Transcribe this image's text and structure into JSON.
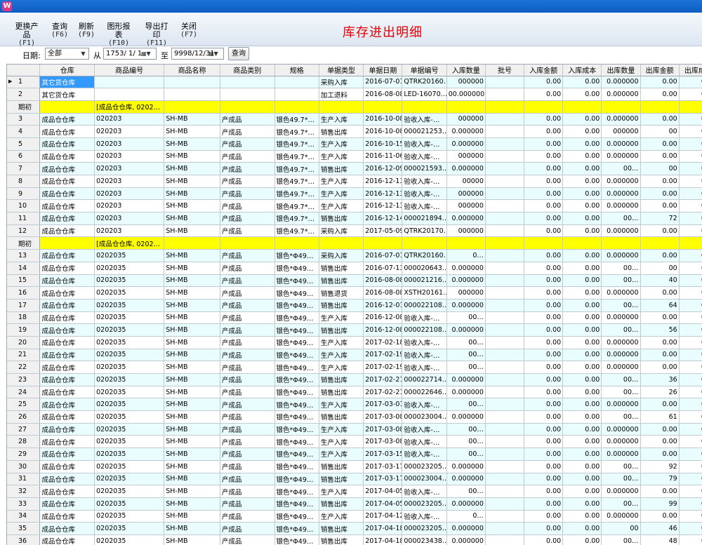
{
  "app_icon": "app-icon",
  "toolbar": {
    "buttons": [
      {
        "label": "更换产品",
        "key": "(F1)"
      },
      {
        "label": "查询",
        "key": "(F6)"
      },
      {
        "label": "刷新",
        "key": "(F9)"
      },
      {
        "label": "图形报表",
        "key": "(F10)"
      },
      {
        "label": "导出打印",
        "key": "(F11)"
      },
      {
        "label": "关闭",
        "key": "(F7)"
      }
    ],
    "title": "库存进出明细"
  },
  "filter": {
    "date_label": "日期:",
    "range_value": "全部",
    "from_label": "从",
    "from_date": "1753/ 1/ 1",
    "to_label": "至",
    "to_date": "9998/12/31",
    "query_label": "查询"
  },
  "grid": {
    "columns": [
      "仓库",
      "商品编号",
      "商品名称",
      "商品类别",
      "规格",
      "单据类型",
      "单据日期",
      "单据编号",
      "入库数量",
      "批号",
      "入库金额",
      "入库成本",
      "出库数量",
      "出库金额",
      "出库成本"
    ],
    "rows": [
      {
        "rh": "1",
        "c": [
          "其它货仓库",
          "",
          "",
          "",
          "",
          "采购入库",
          "2016-07-01",
          "QTRK20160…",
          "000000",
          "",
          "0.00",
          "0.00",
          "0.000000",
          "0.00",
          "0.00"
        ],
        "type": "data",
        "cur": true
      },
      {
        "rh": "2",
        "c": [
          "其它货仓库",
          "",
          "",
          "",
          "",
          "加工退料",
          "2016-08-08",
          "LED-16070…",
          "00.000000",
          "",
          "0.00",
          "0.00",
          "0.000000",
          "0.00",
          "0.00"
        ],
        "type": "data"
      },
      {
        "rh": "期初",
        "c": [
          "",
          "[成品仓仓库, 0202…",
          "",
          "",
          "",
          "",
          "",
          "",
          "",
          "",
          "",
          "",
          "",
          "",
          ""
        ],
        "type": "yellow"
      },
      {
        "rh": "3",
        "c": [
          "成品仓仓库",
          "020203",
          "SH-MB",
          "产成品",
          "银色49.7*…",
          "生产入库",
          "2016-10-08",
          "验收入库-…",
          "000000",
          "",
          "0.00",
          "0.00",
          "0.000000",
          "0.00",
          "0.00"
        ],
        "type": "data"
      },
      {
        "rh": "4",
        "c": [
          "成品仓仓库",
          "020203",
          "SH-MB",
          "产成品",
          "银色49.7*…",
          "销售出库",
          "2016-10-08",
          "000021253…",
          "0.000000",
          "",
          "0.00",
          "0.00",
          "000000",
          "00",
          "0.00"
        ],
        "type": "data"
      },
      {
        "rh": "5",
        "c": [
          "成品仓仓库",
          "020203",
          "SH-MB",
          "产成品",
          "银色49.7*…",
          "生产入库",
          "2016-10-15",
          "验收入库-…",
          "0.000000",
          "",
          "0.00",
          "0.00",
          "0.000000",
          "0.00",
          "0.00"
        ],
        "type": "data"
      },
      {
        "rh": "6",
        "c": [
          "成品仓仓库",
          "020203",
          "SH-MB",
          "产成品",
          "银色49.7*…",
          "生产入库",
          "2016-11-06",
          "验收入库-…",
          "000000",
          "",
          "0.00",
          "0.00",
          "0.000000",
          "0.00",
          "0.00"
        ],
        "type": "data"
      },
      {
        "rh": "7",
        "c": [
          "成品仓仓库",
          "020203",
          "SH-MB",
          "产成品",
          "银色49.7*…",
          "销售出库",
          "2016-12-09",
          "000021593…",
          "0.000000",
          "",
          "0.00",
          "0.00",
          "00…",
          "00",
          "0.00"
        ],
        "type": "data"
      },
      {
        "rh": "8",
        "c": [
          "成品仓仓库",
          "020203",
          "SH-MB",
          "产成品",
          "银色49.7*…",
          "生产入库",
          "2016-12-13",
          "验收入库-…",
          "00000",
          "",
          "0.00",
          "0.00",
          "0.000000",
          "0.00",
          "0.00"
        ],
        "type": "data"
      },
      {
        "rh": "9",
        "c": [
          "成品仓仓库",
          "020203",
          "SH-MB",
          "产成品",
          "银色49.7*…",
          "生产入库",
          "2016-12-13",
          "验收入库-…",
          "000000",
          "",
          "0.00",
          "0.00",
          "0.000000",
          "0.00",
          "0.00"
        ],
        "type": "data"
      },
      {
        "rh": "10",
        "c": [
          "成品仓仓库",
          "020203",
          "SH-MB",
          "产成品",
          "银色49.7*…",
          "生产入库",
          "2016-12-13",
          "验收入库-…",
          "000000",
          "",
          "0.00",
          "0.00",
          "0.000000",
          "0.00",
          "0.00"
        ],
        "type": "data"
      },
      {
        "rh": "11",
        "c": [
          "成品仓仓库",
          "020203",
          "SH-MB",
          "产成品",
          "银色49.7*…",
          "销售出库",
          "2016-12-14",
          "000021894…",
          "0.000000",
          "",
          "0.00",
          "0.00",
          "00…",
          "72",
          "0.00"
        ],
        "type": "data"
      },
      {
        "rh": "12",
        "c": [
          "成品仓仓库",
          "020203",
          "SH-MB",
          "产成品",
          "银色49.7*…",
          "采购入库",
          "2017-05-09",
          "QTRK20170…",
          "000000",
          "",
          "0.00",
          "0.00",
          "0.000000",
          "0.00",
          "0.00"
        ],
        "type": "data"
      },
      {
        "rh": "期初",
        "c": [
          "",
          "[成品仓仓库, 0202…",
          "",
          "",
          "",
          "",
          "",
          "",
          "",
          "",
          "",
          "",
          "",
          "",
          ""
        ],
        "type": "yellow"
      },
      {
        "rh": "13",
        "c": [
          "成品仓仓库",
          "0202035",
          "SH-MB",
          "产成品",
          "银色*Φ49…",
          "采购入库",
          "2016-07-01",
          "QTRK20160…",
          "0…",
          "",
          "0.00",
          "0.00",
          "0.000000",
          "0.00",
          "0.00"
        ],
        "type": "data"
      },
      {
        "rh": "14",
        "c": [
          "成品仓仓库",
          "0202035",
          "SH-MB",
          "产成品",
          "银色*Φ49…",
          "销售出库",
          "2016-07-13",
          "000020643…",
          "0.000000",
          "",
          "0.00",
          "0.00",
          "00…",
          "00",
          "0.00"
        ],
        "type": "data"
      },
      {
        "rh": "15",
        "c": [
          "成品仓仓库",
          "0202035",
          "SH-MB",
          "产成品",
          "银色*Φ49…",
          "销售出库",
          "2016-08-08",
          "000021216…",
          "0.000000",
          "",
          "0.00",
          "0.00",
          "00…",
          "40",
          "0.00"
        ],
        "type": "data"
      },
      {
        "rh": "16",
        "c": [
          "成品仓仓库",
          "0202035",
          "SH-MB",
          "产成品",
          "银色*Φ49…",
          "销售退货",
          "2016-08-08",
          "XSTH20161…",
          "000000",
          "",
          "0.00",
          "0.00",
          "0.000000",
          "0.00",
          "0.00"
        ],
        "type": "data"
      },
      {
        "rh": "17",
        "c": [
          "成品仓仓库",
          "0202035",
          "SH-MB",
          "产成品",
          "银色*Φ49…",
          "销售出库",
          "2016-12-01",
          "000022108…",
          "0.000000",
          "",
          "0.00",
          "0.00",
          "00…",
          "64",
          "0.00"
        ],
        "type": "data"
      },
      {
        "rh": "18",
        "c": [
          "成品仓仓库",
          "0202035",
          "SH-MB",
          "产成品",
          "银色*Φ49…",
          "生产入库",
          "2016-12-08",
          "验收入库-…",
          "00…",
          "",
          "0.00",
          "0.00",
          "0.000000",
          "0.00",
          "0.00"
        ],
        "type": "data"
      },
      {
        "rh": "19",
        "c": [
          "成品仓仓库",
          "0202035",
          "SH-MB",
          "产成品",
          "银色*Φ49…",
          "销售出库",
          "2016-12-08",
          "000022108…",
          "0.000000",
          "",
          "0.00",
          "0.00",
          "00…",
          "56",
          "0.00"
        ],
        "type": "data"
      },
      {
        "rh": "20",
        "c": [
          "成品仓仓库",
          "0202035",
          "SH-MB",
          "产成品",
          "银色*Φ49…",
          "生产入库",
          "2017-02-18",
          "验收入库-…",
          "00…",
          "",
          "0.00",
          "0.00",
          "0.000000",
          "0.00",
          "0.00"
        ],
        "type": "data"
      },
      {
        "rh": "21",
        "c": [
          "成品仓仓库",
          "0202035",
          "SH-MB",
          "产成品",
          "银色*Φ49…",
          "生产入库",
          "2017-02-19",
          "验收入库-…",
          "00…",
          "",
          "0.00",
          "0.00",
          "0.000000",
          "0.00",
          "0.00"
        ],
        "type": "data"
      },
      {
        "rh": "22",
        "c": [
          "成品仓仓库",
          "0202035",
          "SH-MB",
          "产成品",
          "银色*Φ49…",
          "生产入库",
          "2017-02-19",
          "验收入库-…",
          "00…",
          "",
          "0.00",
          "0.00",
          "0.000000",
          "0.00",
          "0.00"
        ],
        "type": "data"
      },
      {
        "rh": "23",
        "c": [
          "成品仓仓库",
          "0202035",
          "SH-MB",
          "产成品",
          "银色*Φ49…",
          "销售出库",
          "2017-02-21",
          "000022714…",
          "0.000000",
          "",
          "0.00",
          "0.00",
          "00…",
          "36",
          "0.00"
        ],
        "type": "data"
      },
      {
        "rh": "24",
        "c": [
          "成品仓仓库",
          "0202035",
          "SH-MB",
          "产成品",
          "银色*Φ49…",
          "销售出库",
          "2017-02-21",
          "000022646…",
          "0.000000",
          "",
          "0.00",
          "0.00",
          "00…",
          "26",
          "0.00"
        ],
        "type": "data"
      },
      {
        "rh": "25",
        "c": [
          "成品仓仓库",
          "0202035",
          "SH-MB",
          "产成品",
          "银色*Φ49…",
          "生产入库",
          "2017-03-01",
          "验收入库-…",
          "00…",
          "",
          "0.00",
          "0.00",
          "0.000000",
          "0.00",
          "0.00"
        ],
        "type": "data"
      },
      {
        "rh": "26",
        "c": [
          "成品仓仓库",
          "0202035",
          "SH-MB",
          "产成品",
          "银色*Φ49…",
          "销售出库",
          "2017-03-08",
          "000023004…",
          "0.000000",
          "",
          "0.00",
          "0.00",
          "00…",
          "61",
          "0.00"
        ],
        "type": "data"
      },
      {
        "rh": "27",
        "c": [
          "成品仓仓库",
          "0202035",
          "SH-MB",
          "产成品",
          "银色*Φ49…",
          "生产入库",
          "2017-03-08",
          "验收入库-…",
          "00…",
          "",
          "0.00",
          "0.00",
          "0.000000",
          "0.00",
          "0.00"
        ],
        "type": "data"
      },
      {
        "rh": "28",
        "c": [
          "成品仓仓库",
          "0202035",
          "SH-MB",
          "产成品",
          "银色*Φ49…",
          "生产入库",
          "2017-03-08",
          "验收入库-…",
          "00…",
          "",
          "0.00",
          "0.00",
          "0.000000",
          "0.00",
          "0.00"
        ],
        "type": "data"
      },
      {
        "rh": "29",
        "c": [
          "成品仓仓库",
          "0202035",
          "SH-MB",
          "产成品",
          "银色*Φ49…",
          "生产入库",
          "2017-03-15",
          "验收入库-…",
          "00…",
          "",
          "0.00",
          "0.00",
          "0.000000",
          "0.00",
          "0.00"
        ],
        "type": "data"
      },
      {
        "rh": "30",
        "c": [
          "成品仓仓库",
          "0202035",
          "SH-MB",
          "产成品",
          "银色*Φ49…",
          "销售出库",
          "2017-03-17",
          "000023205…",
          "0.000000",
          "",
          "0.00",
          "0.00",
          "00…",
          "92",
          "0.00"
        ],
        "type": "data"
      },
      {
        "rh": "31",
        "c": [
          "成品仓仓库",
          "0202035",
          "SH-MB",
          "产成品",
          "银色*Φ49…",
          "销售出库",
          "2017-03-17",
          "000023004…",
          "0.000000",
          "",
          "0.00",
          "0.00",
          "00…",
          "79",
          "0.00"
        ],
        "type": "data"
      },
      {
        "rh": "32",
        "c": [
          "成品仓仓库",
          "0202035",
          "SH-MB",
          "产成品",
          "银色*Φ49…",
          "生产入库",
          "2017-04-05",
          "验收入库-…",
          "00…",
          "",
          "0.00",
          "0.00",
          "0.000000",
          "0.00",
          "0.00"
        ],
        "type": "data"
      },
      {
        "rh": "33",
        "c": [
          "成品仓仓库",
          "0202035",
          "SH-MB",
          "产成品",
          "银色*Φ49…",
          "销售出库",
          "2017-04-05",
          "000023205…",
          "0.000000",
          "",
          "0.00",
          "0.00",
          "00…",
          "99",
          "0.00"
        ],
        "type": "data"
      },
      {
        "rh": "34",
        "c": [
          "成品仓仓库",
          "0202035",
          "SH-MB",
          "产成品",
          "银色*Φ49…",
          "生产入库",
          "2017-04-12",
          "验收入库-…",
          "0…",
          "",
          "0.00",
          "0.00",
          "0.000000",
          "0.00",
          "0.00"
        ],
        "type": "data"
      },
      {
        "rh": "35",
        "c": [
          "成品仓仓库",
          "0202035",
          "SH-MB",
          "产成品",
          "银色*Φ49…",
          "销售出库",
          "2017-04-18",
          "000023205…",
          "0.000000",
          "",
          "0.00",
          "0.00",
          "00",
          "46",
          "0.00"
        ],
        "type": "data"
      },
      {
        "rh": "36",
        "c": [
          "成品仓仓库",
          "0202035",
          "SH-MB",
          "产成品",
          "银色*Φ49…",
          "销售出库",
          "2017-04-18",
          "000023438…",
          "0.000000",
          "",
          "0.00",
          "0.00",
          "00…",
          "48",
          "0.00"
        ],
        "type": "data"
      }
    ]
  }
}
